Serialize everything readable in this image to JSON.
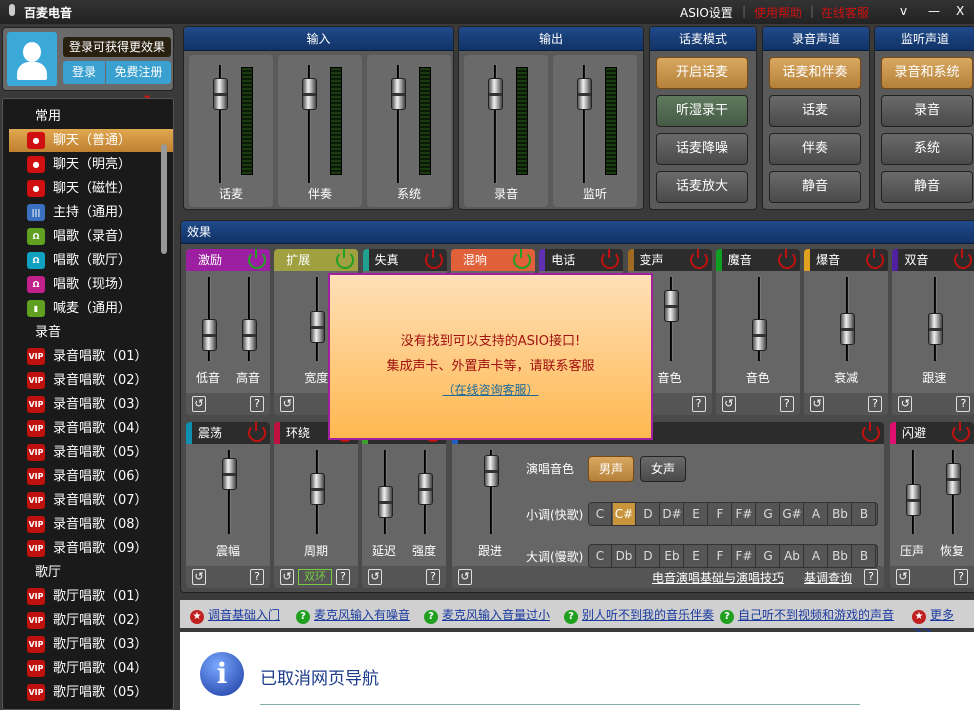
{
  "app": {
    "title": "百麦电音",
    "links": [
      "ASIO设置",
      "使用帮助",
      "在线客服"
    ],
    "min": "—",
    "close": "X",
    "menu": "v"
  },
  "user": {
    "promo": "登录可获得更效果",
    "login": "登录",
    "register": "免费注册"
  },
  "sidebar": {
    "groups": [
      {
        "label": "常用",
        "items": [
          {
            "label": "聊天（普通）",
            "icon": "chat",
            "selected": true
          },
          {
            "label": "聊天（明亮）",
            "icon": "chat"
          },
          {
            "label": "聊天（磁性）",
            "icon": "chat"
          },
          {
            "label": "主持（通用）",
            "icon": "bars"
          },
          {
            "label": "唱歌（录音）",
            "icon": "headphone-green"
          },
          {
            "label": "唱歌（歌厅）",
            "icon": "headphone-teal"
          },
          {
            "label": "唱歌（现场）",
            "icon": "headphone-pink"
          },
          {
            "label": "喊麦（通用）",
            "icon": "mic"
          }
        ]
      },
      {
        "label": "录音",
        "items": [
          {
            "label": "录音唱歌（01）",
            "icon": "vip"
          },
          {
            "label": "录音唱歌（02）",
            "icon": "vip"
          },
          {
            "label": "录音唱歌（03）",
            "icon": "vip"
          },
          {
            "label": "录音唱歌（04）",
            "icon": "vip"
          },
          {
            "label": "录音唱歌（05）",
            "icon": "vip"
          },
          {
            "label": "录音唱歌（06）",
            "icon": "vip"
          },
          {
            "label": "录音唱歌（07）",
            "icon": "vip"
          },
          {
            "label": "录音唱歌（08）",
            "icon": "vip"
          },
          {
            "label": "录音唱歌（09）",
            "icon": "vip"
          }
        ]
      },
      {
        "label": "歌厅",
        "items": [
          {
            "label": "歌厅唱歌（01）",
            "icon": "vip"
          },
          {
            "label": "歌厅唱歌（02）",
            "icon": "vip"
          },
          {
            "label": "歌厅唱歌（03）",
            "icon": "vip"
          },
          {
            "label": "歌厅唱歌（04）",
            "icon": "vip"
          },
          {
            "label": "歌厅唱歌（05）",
            "icon": "vip"
          }
        ]
      }
    ],
    "vip_text": "VIP"
  },
  "input": {
    "title": "输入",
    "channels": [
      {
        "label": "话麦",
        "level": 0.85
      },
      {
        "label": "伴奏",
        "level": 0.85
      },
      {
        "label": "系统",
        "level": 0.85
      }
    ]
  },
  "output": {
    "title": "输出",
    "channels": [
      {
        "label": "录音",
        "level": 0.85
      },
      {
        "label": "监听",
        "level": 0.85
      }
    ]
  },
  "mic_mode": {
    "title": "话麦模式",
    "buttons": [
      {
        "label": "开启话麦",
        "state": "on"
      },
      {
        "label": "听湿录干",
        "state": "green"
      },
      {
        "label": "话麦降噪"
      },
      {
        "label": "话麦放大"
      }
    ]
  },
  "rec_channel": {
    "title": "录音声道",
    "buttons": [
      {
        "label": "话麦和伴奏",
        "state": "on"
      },
      {
        "label": "话麦"
      },
      {
        "label": "伴奏"
      },
      {
        "label": "静音"
      }
    ]
  },
  "mon_channel": {
    "title": "监听声道",
    "buttons": [
      {
        "label": "录音和系统",
        "state": "on"
      },
      {
        "label": "录音"
      },
      {
        "label": "系统"
      },
      {
        "label": "静音"
      }
    ]
  },
  "effects": {
    "title": "效果",
    "row1": [
      {
        "name": "激励",
        "color": "#9b1fa0",
        "fill": true,
        "on": true,
        "sliders": [
          {
            "label": "低音",
            "value": 0.2
          },
          {
            "label": "高音",
            "value": 0.2
          }
        ]
      },
      {
        "name": "扩展",
        "color": "#a0a040",
        "fill": true,
        "on": true,
        "sliders": [
          {
            "label": "宽度",
            "value": 0.35
          }
        ]
      },
      {
        "name": "失真",
        "color": "#20a090",
        "on": false,
        "sliders": []
      },
      {
        "name": "混响",
        "color": "#e0603a",
        "fill": true,
        "on": true,
        "sliders": []
      },
      {
        "name": "电话",
        "color": "#6030b0",
        "on": false,
        "sliders": []
      },
      {
        "name": "变声",
        "color": "#a06a20",
        "on": false,
        "sliders": [
          {
            "label": "音色",
            "value": 0.75
          }
        ]
      },
      {
        "name": "魔音",
        "color": "#10a020",
        "on": false,
        "sliders": [
          {
            "label": "音色",
            "value": 0.2
          }
        ]
      },
      {
        "name": "爆音",
        "color": "#e0a020",
        "on": false,
        "sliders": [
          {
            "label": "衰减",
            "value": 0.3
          }
        ]
      },
      {
        "name": "双音",
        "color": "#5020a0",
        "on": false,
        "sliders": [
          {
            "label": "跟速",
            "value": 0.3
          }
        ]
      }
    ],
    "row2": [
      {
        "name": "震荡",
        "color": "#1090b0",
        "on": false,
        "sliders": [
          {
            "label": "震幅",
            "value": 0.85
          }
        ]
      },
      {
        "name": "环绕",
        "color": "#c01040",
        "on": false,
        "sliders": [
          {
            "label": "周期",
            "value": 0.55
          }
        ],
        "dropdown": "双环"
      },
      {
        "name": "",
        "color": "#40a030",
        "on": false,
        "sliders": [
          {
            "label": "延迟",
            "value": 0.3
          },
          {
            "label": "强度",
            "value": 0.55
          }
        ]
      },
      {
        "name": "",
        "color": "#2060c0",
        "on": false,
        "sliders": [
          {
            "label": "跟进",
            "value": 0.9
          }
        ],
        "electro": true
      },
      {
        "name": "闪避",
        "color": "#e01070",
        "on": false,
        "sliders": [
          {
            "label": "压声",
            "value": 0.35
          },
          {
            "label": "恢复",
            "value": 0.75
          }
        ]
      }
    ],
    "electro": {
      "voice_label": "演唱音色",
      "male": "男声",
      "female": "女声",
      "minor_label": "小调(快歌)",
      "major_label": "大调(慢歌)",
      "minor_keys": [
        "C",
        "C#",
        "D",
        "D#",
        "E",
        "F",
        "F#",
        "G",
        "G#",
        "A",
        "Bb",
        "B"
      ],
      "minor_selected": "C#",
      "major_keys": [
        "C",
        "Db",
        "D",
        "Eb",
        "E",
        "F",
        "F#",
        "G",
        "Ab",
        "A",
        "Bb",
        "B"
      ],
      "link1": "电音演唱基础与演唱技巧",
      "link2": "基调查询"
    }
  },
  "popup": {
    "line1": "没有找到可以支持的ASIO接口!",
    "line2": "集成声卡、外置声卡等，请联系客服",
    "link": "（在线咨询客服）"
  },
  "helpbar": [
    {
      "label": "调音基础入门",
      "icon": "star"
    },
    {
      "label": "麦克风输入有噪音",
      "icon": "question"
    },
    {
      "label": "麦克风输入音量过小",
      "icon": "question"
    },
    {
      "label": "别人听不到我的音乐伴奏",
      "icon": "question"
    },
    {
      "label": "自己听不到视频和游戏的声音",
      "icon": "question"
    },
    {
      "label": "更多>>",
      "icon": "star"
    }
  ],
  "browser": {
    "message": "已取消网页导航",
    "icon_text": "i"
  }
}
